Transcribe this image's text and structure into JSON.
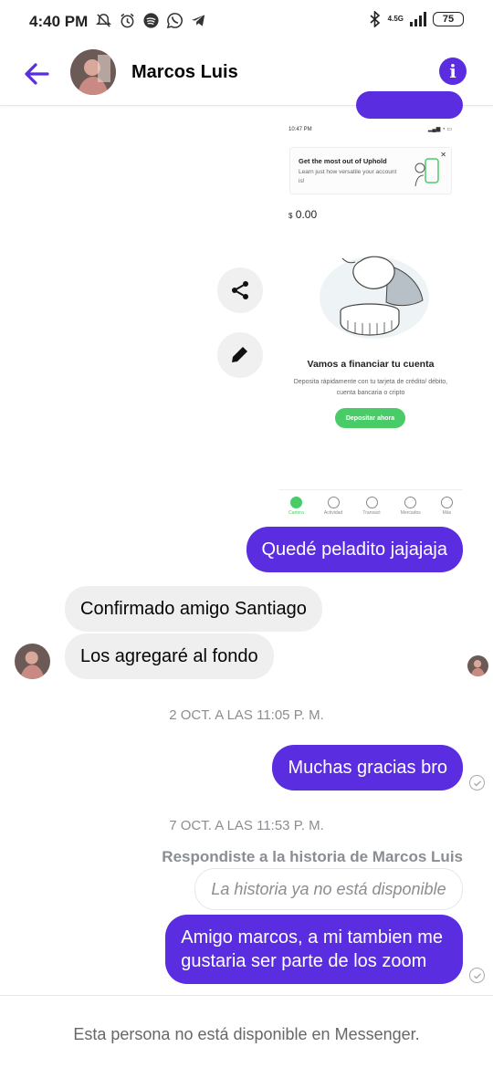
{
  "status_bar": {
    "time": "4:40 PM",
    "network": "4.5G",
    "battery": "75"
  },
  "header": {
    "contact_name": "Marcos Luis",
    "back_icon": "back-arrow-icon",
    "info_icon": "info-icon"
  },
  "shared_image": {
    "status_time": "10:47 PM",
    "card_title": "Get the most out of Uphold",
    "card_text": "Learn just how versatile your account is!",
    "currency": "$",
    "amount": "0.00",
    "heading": "Vamos a financiar tu cuenta",
    "subtext": "Deposita rápidamente con tu tarjeta de crédito/ débito, cuenta bancaria o cripto",
    "button": "Depositar ahora",
    "nav": [
      "Cartera",
      "Actividad",
      "Transact",
      "Mercados",
      "Más"
    ]
  },
  "actions": {
    "share_icon": "share-icon",
    "edit_icon": "pencil-icon"
  },
  "messages": {
    "out_1": "Quedé peladito jajajaja",
    "in_1": "Confirmado amigo Santiago",
    "in_2": "Los agregaré al fondo",
    "timestamp_1": "2 OCT. A LAS 11:05 P. M.",
    "out_2": "Muchas gracias bro",
    "timestamp_2": "7 OCT. A LAS 11:53 P. M.",
    "reply_note": "Respondiste a la historia de Marcos Luis",
    "story_unavailable": "La historia ya no está disponible",
    "out_3_line1": "Amigo marcos, a mi tambien me",
    "out_3_line2": "gustaria ser parte de los zoom"
  },
  "footer": {
    "notice": "Esta persona no está disponible en Messenger."
  },
  "colors": {
    "accent": "#5b2de1",
    "incoming_bubble": "#efefef",
    "meta_text": "#8a8d91",
    "uphold_green": "#49cc68"
  }
}
